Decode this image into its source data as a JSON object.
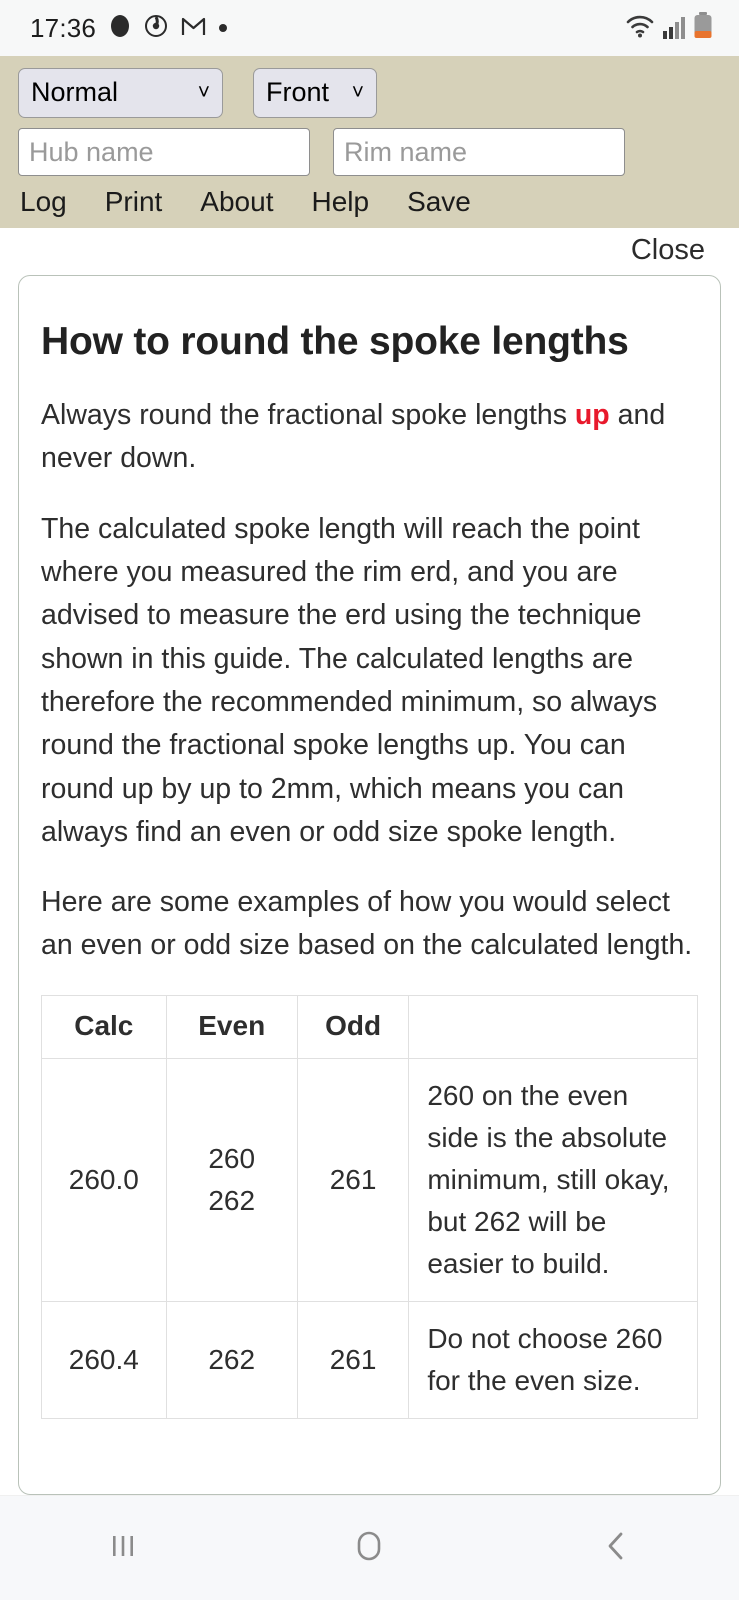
{
  "statusbar": {
    "time": "17:36",
    "icons": [
      "fingerprint-icon",
      "activity-icon",
      "gmail-icon",
      "dot-icon"
    ],
    "right_icons": [
      "wifi-icon",
      "signal-icon",
      "battery-icon"
    ]
  },
  "toolbar": {
    "spoke_pattern_value": "Normal",
    "wheel_side_value": "Front",
    "hub_name_value": "",
    "hub_name_placeholder": "Hub name",
    "rim_name_value": "",
    "rim_name_placeholder": "Rim name",
    "menu": [
      {
        "label": "Log"
      },
      {
        "label": "Print"
      },
      {
        "label": "About"
      },
      {
        "label": "Help"
      },
      {
        "label": "Save"
      }
    ]
  },
  "overlay": {
    "close_label": "Close",
    "title": "How to round the spoke lengths",
    "paragraph1_pre": "Always round the fractional spoke lengths ",
    "paragraph1_highlight": "up",
    "paragraph1_post": " and never down.",
    "paragraph2": "The calculated spoke length will reach the point where you measured the rim erd, and you are advised to measure the erd using the technique shown in this guide. The calculated lengths are therefore the recommended minimum, so always round the fractional spoke lengths up. You can round up by up to 2mm, which means you can always find an even or odd size spoke length.",
    "paragraph3": "Here are some examples of how you would select an even or odd size based on the calculated length.",
    "table": {
      "headers": [
        "Calc",
        "Even",
        "Odd",
        ""
      ],
      "rows": [
        {
          "calc": "260.0",
          "even_line1": "260",
          "even_line2": "262",
          "odd": "261",
          "note": "260 on the even side is the absolute minimum, still okay, but 262 will be easier to build."
        },
        {
          "calc": "260.4",
          "even_line1": "262",
          "even_line2": "",
          "odd": "261",
          "note": "Do not choose 260 for the even size."
        }
      ]
    }
  },
  "navbar": {
    "recents_label": "recent-apps",
    "home_label": "home",
    "back_label": "back"
  },
  "colors": {
    "toolbar_bg": "#d6d1b9",
    "highlight_red": "#e8192c",
    "card_border": "#b9c2b9"
  }
}
